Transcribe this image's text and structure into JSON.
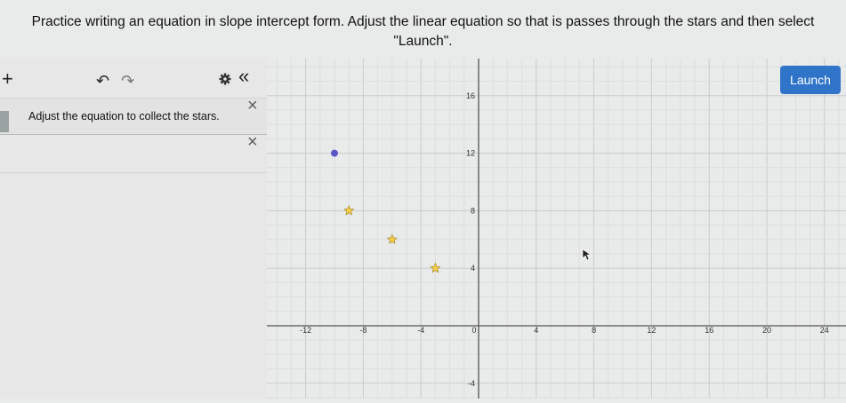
{
  "prompt": {
    "line1": "Practice writing an equation in slope intercept form. Adjust the linear equation so that is passes through the stars and then select",
    "line2": "\"Launch\"."
  },
  "expression_list": {
    "add_icon": "+",
    "undo_icon": "↶",
    "redo_icon": "↷",
    "settings_icon": "gear-icon",
    "collapse_icon": "«",
    "expressions": [
      {
        "text": "Adjust the equation to collect the stars.",
        "delete_icon": "×"
      },
      {
        "text": "",
        "delete_icon": "×"
      }
    ]
  },
  "graph": {
    "launch_label": "Launch",
    "x_ticks": [
      "-12",
      "-8",
      "-4",
      "0",
      "4",
      "8",
      "12",
      "16",
      "20",
      "24"
    ],
    "y_ticks": [
      "16",
      "12",
      "8",
      "4",
      "-4"
    ],
    "point": {
      "x": -10,
      "y": 12,
      "color": "#5b55c7"
    },
    "stars": [
      {
        "x": -9,
        "y": 8
      },
      {
        "x": -6,
        "y": 6
      },
      {
        "x": -3,
        "y": 4
      }
    ],
    "accent": "#2f74c9",
    "star_color": "#f2cf4a"
  }
}
